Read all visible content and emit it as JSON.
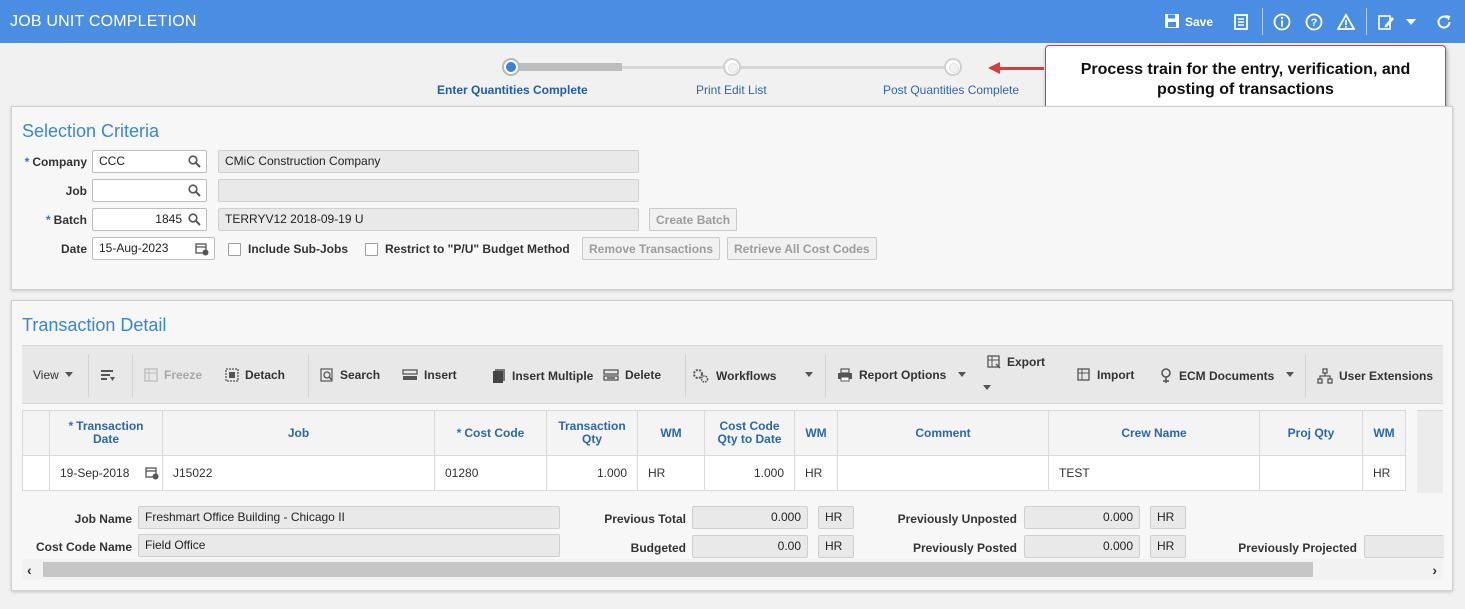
{
  "app": {
    "title": "JOB UNIT COMPLETION",
    "save_label": "Save",
    "colors": {
      "header": "#4a8ee4",
      "accent": "#3a82e0",
      "callout_border": "#d23f3f",
      "title_blue": "#3a86dc"
    }
  },
  "train": {
    "steps": [
      {
        "label": "Enter Quantities Complete",
        "state": "current"
      },
      {
        "label": "Print Edit List",
        "state": "upcoming"
      },
      {
        "label": "Post Quantities Complete",
        "state": "upcoming"
      }
    ],
    "callout": "Process train for the entry, verification, and posting of transactions"
  },
  "selection": {
    "title": "Selection Criteria",
    "company": {
      "label": "Company",
      "value": "CCC",
      "name": "CMiC Construction Company"
    },
    "job": {
      "label": "Job",
      "value": "",
      "name": ""
    },
    "batch": {
      "label": "Batch",
      "value": "1845",
      "name": "TERRYV12 2018-09-19 U"
    },
    "date": {
      "label": "Date",
      "value": "15-Aug-2023"
    },
    "include_sub_jobs": "Include Sub-Jobs",
    "restrict_pu": "Restrict to \"P/U\" Budget Method",
    "create_batch": "Create Batch",
    "remove_transactions": "Remove Transactions",
    "retrieve_all": "Retrieve All Cost Codes"
  },
  "detail": {
    "title": "Transaction Detail",
    "toolbar": {
      "view": "View",
      "freeze": "Freeze",
      "detach": "Detach",
      "search": "Search",
      "insert": "Insert",
      "insert_multiple": "Insert Multiple",
      "delete": "Delete",
      "workflows": "Workflows",
      "report_options": "Report Options",
      "export": "Export",
      "import": "Import",
      "ecm_documents": "ECM Documents",
      "user_extensions": "User Extensions"
    },
    "columns": {
      "trans_date": "Transaction Date",
      "job": "Job",
      "cost_code": "Cost Code",
      "trans_qty": "Transaction Qty",
      "wm1": "WM",
      "cc_qty_to_date": "Cost Code Qty to Date",
      "wm2": "WM",
      "comment": "Comment",
      "crew_name": "Crew Name",
      "proj_qty": "Proj Qty",
      "wm3": "WM"
    },
    "row": {
      "trans_date": "19-Sep-2018",
      "job": "J15022",
      "cost_code": "01280",
      "trans_qty": "1.000",
      "wm1": "HR",
      "cc_qty_to_date": "1.000",
      "wm2": "HR",
      "comment": "",
      "crew_name": "TEST",
      "proj_qty": "",
      "wm3": "HR"
    },
    "footer": {
      "job_name_label": "Job Name",
      "job_name": "Freshmart Office Building - Chicago II",
      "cost_code_name_label": "Cost Code Name",
      "cost_code_name": "Field Office",
      "previous_total_label": "Previous Total",
      "previous_total": "0.000",
      "previous_total_uom": "HR",
      "budgeted_label": "Budgeted",
      "budgeted": "0.00",
      "budgeted_uom": "HR",
      "prev_unposted_label": "Previously Unposted",
      "prev_unposted": "0.000",
      "prev_unposted_uom": "HR",
      "prev_posted_label": "Previously Posted",
      "prev_posted": "0.000",
      "prev_posted_uom": "HR",
      "prev_projected_label": "Previously Projected"
    }
  }
}
